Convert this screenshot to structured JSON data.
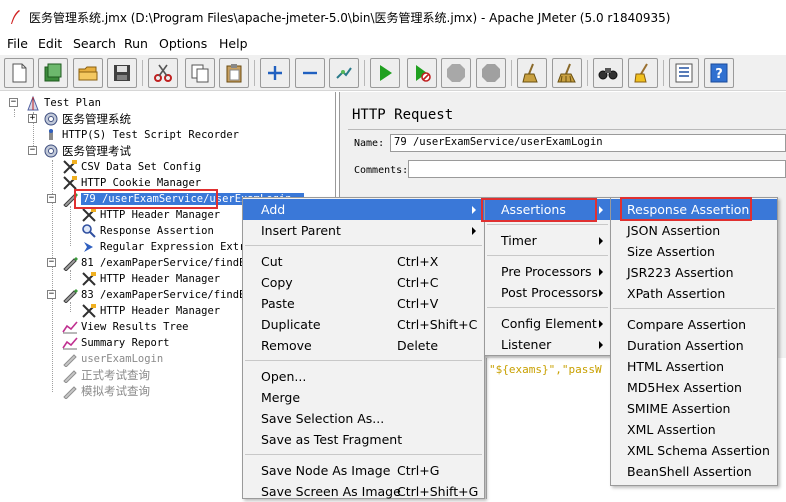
{
  "window": {
    "title": "医务管理系统.jmx (D:\\Program Files\\apache-jmeter-5.0\\bin\\医务管理系统.jmx) - Apache JMeter (5.0 r1840935)"
  },
  "menubar": [
    "File",
    "Edit",
    "Search",
    "Run",
    "Options",
    "Help"
  ],
  "toolbar_icons": [
    "new-icon",
    "templates-icon",
    "open-icon",
    "save-icon",
    "cut-icon",
    "copy-icon",
    "paste-icon",
    "expand-icon",
    "collapse-icon",
    "toggle-icon",
    "start-icon",
    "start-no-pause-icon",
    "stop-icon",
    "shutdown-icon",
    "clear-icon",
    "clear-all-icon",
    "search-icon",
    "reset-search-icon",
    "function-helper-icon",
    "help-icon"
  ],
  "tree": {
    "test_plan": "Test Plan",
    "nodes": [
      "医务管理系统",
      "HTTP(S) Test Script Recorder",
      "医务管理考试",
      "CSV Data Set Config",
      "HTTP Cookie Manager",
      "79 /userExamService/userExamLogin",
      "HTTP Header Manager",
      "Response Assertion",
      "Regular Expression Extr",
      "81 /examPaperService/findE",
      "HTTP Header Manager",
      "83 /examPaperService/findE",
      "HTTP Header Manager",
      "View Results Tree",
      "Summary Report",
      "userExamLogin",
      "正式考试查询",
      "模拟考试查询"
    ]
  },
  "panel": {
    "title": "HTTP Request",
    "name_label": "Name:",
    "name_value": "79 /userExamService/userExamLogin",
    "comments_label": "Comments:",
    "code_snippet": "\"${exams}\",\"passW"
  },
  "context_menu": [
    {
      "label": "Add",
      "shortcut": ""
    },
    {
      "label": "Insert Parent",
      "shortcut": ""
    },
    {
      "label": "Cut",
      "shortcut": "Ctrl+X"
    },
    {
      "label": "Copy",
      "shortcut": "Ctrl+C"
    },
    {
      "label": "Paste",
      "shortcut": "Ctrl+V"
    },
    {
      "label": "Duplicate",
      "shortcut": "Ctrl+Shift+C"
    },
    {
      "label": "Remove",
      "shortcut": "Delete"
    },
    {
      "label": "Open...",
      "shortcut": ""
    },
    {
      "label": "Merge",
      "shortcut": ""
    },
    {
      "label": "Save Selection As...",
      "shortcut": ""
    },
    {
      "label": "Save as Test Fragment",
      "shortcut": ""
    },
    {
      "label": "Save Node As Image",
      "shortcut": "Ctrl+G"
    },
    {
      "label": "Save Screen As Image",
      "shortcut": "Ctrl+Shift+G"
    }
  ],
  "add_submenu": [
    "Assertions",
    "Timer",
    "Pre Processors",
    "Post Processors",
    "Config Element",
    "Listener"
  ],
  "assertions_submenu": [
    "Response Assertion",
    "JSON Assertion",
    "Size Assertion",
    "JSR223 Assertion",
    "XPath Assertion",
    "Compare Assertion",
    "Duration Assertion",
    "HTML Assertion",
    "MD5Hex Assertion",
    "SMIME Assertion",
    "XML Assertion",
    "XML Schema Assertion",
    "BeanShell Assertion"
  ],
  "colors": {
    "highlight": "#3a78d8",
    "annotation_box": "#e03030"
  }
}
